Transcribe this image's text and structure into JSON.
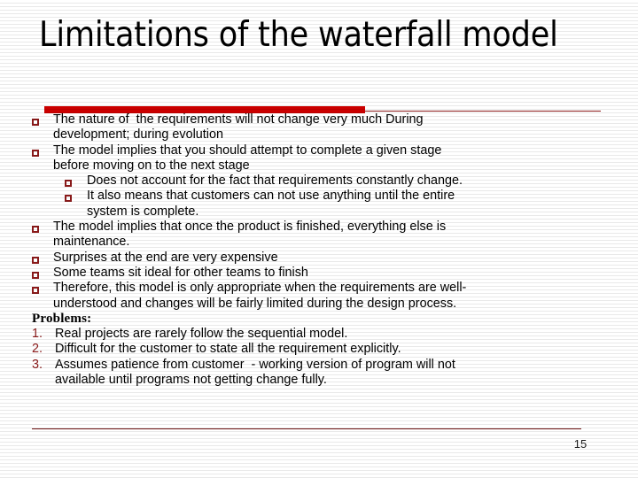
{
  "slide": {
    "title": "Limitations of the waterfall model",
    "page_number": "15",
    "accent_color": "#CC0000",
    "rule_color": "#8B1A1A",
    "bullet_color": "#8B1A1A",
    "text_color": "#000000",
    "background_color": "#FFFFFF"
  },
  "bullets": [
    {
      "level": 1,
      "marker": "square-bullet",
      "lines": [
        "The nature of  the requirements will not change very much During",
        "development; during evolution"
      ]
    },
    {
      "level": 1,
      "marker": "square-bullet",
      "lines": [
        "The model implies that you should attempt to complete a given stage",
        "before moving on to the next stage"
      ]
    },
    {
      "level": 2,
      "marker": "square-bullet",
      "lines": [
        "Does not account for the fact that requirements constantly change."
      ]
    },
    {
      "level": 2,
      "marker": "square-bullet",
      "lines": [
        "It also means that customers can not use anything until the entire",
        "system is complete."
      ]
    },
    {
      "level": 1,
      "marker": "square-bullet",
      "lines": [
        "The model implies that once the product is finished, everything else is",
        "maintenance."
      ]
    },
    {
      "level": 1,
      "marker": "square-bullet",
      "lines": [
        "Surprises at the end are very expensive"
      ]
    },
    {
      "level": 1,
      "marker": "square-bullet",
      "lines": [
        "Some teams sit ideal for other teams to finish"
      ]
    },
    {
      "level": 1,
      "marker": "square-bullet",
      "lines": [
        "Therefore, this model is only appropriate when the requirements are well-",
        "understood and changes will be fairly limited during the design process."
      ]
    }
  ],
  "problems": {
    "heading": "Problems:",
    "items": [
      {
        "number": "1.",
        "lines": [
          "Real projects are rarely follow the sequential model."
        ]
      },
      {
        "number": "2.",
        "lines": [
          "Difficult for the customer to state all the requirement explicitly."
        ]
      },
      {
        "number": "3.",
        "lines": [
          "Assumes patience from customer  - working version of program will not",
          "available until programs not getting change fully."
        ]
      }
    ]
  }
}
